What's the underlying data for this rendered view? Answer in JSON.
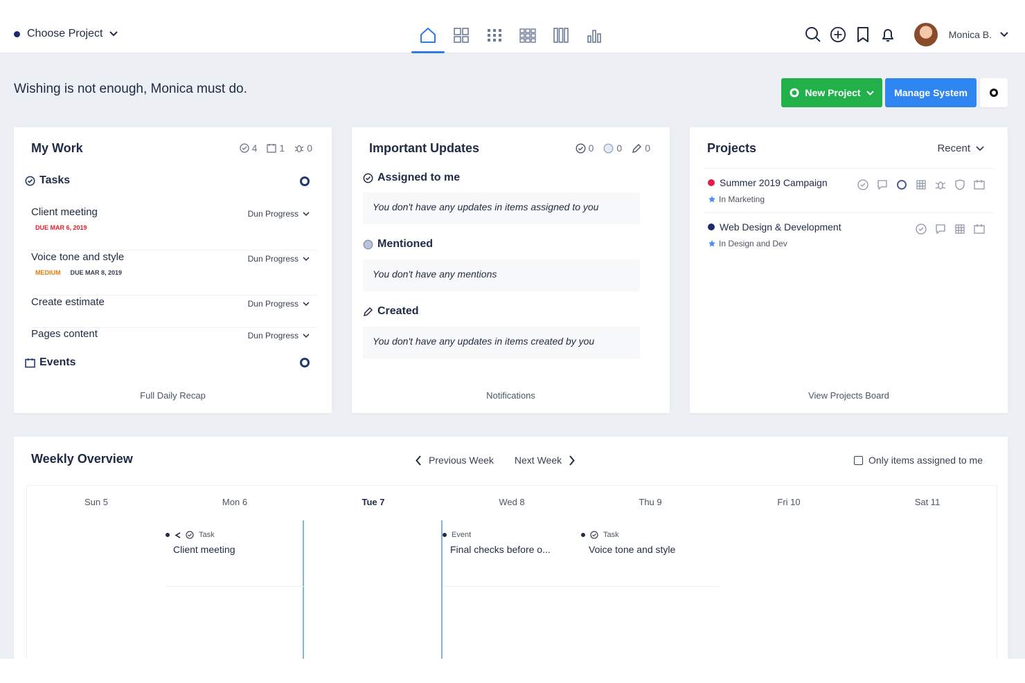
{
  "header": {
    "project_select": "Choose Project",
    "user_name": "Monica B.",
    "nav": [
      "home-icon",
      "grid-icon",
      "dots-grid-icon",
      "blocks-icon",
      "board-icon",
      "chart-icon"
    ]
  },
  "motto": "Wishing is not enough, Monica must do.",
  "actions": {
    "new_project": "New Project",
    "manage_system": "Manage System"
  },
  "my_work": {
    "title": "My Work",
    "counts": {
      "tasks": "4",
      "events": "1",
      "bugs": "0"
    },
    "tasks_label": "Tasks",
    "events_label": "Events",
    "status_label": "Dun Progress",
    "tasks": [
      {
        "name": "Client meeting",
        "due": "DUE MAR 6, 2019",
        "priority": ""
      },
      {
        "name": "Voice tone and style",
        "due": "DUE MAR 8, 2019",
        "priority": "MEDIUM"
      },
      {
        "name": "Create estimate",
        "due": "",
        "priority": ""
      },
      {
        "name": "Pages content",
        "due": "",
        "priority": ""
      }
    ],
    "footer": "Full Daily Recap"
  },
  "updates": {
    "title": "Important Updates",
    "counts": {
      "assigned": "0",
      "mentioned": "0",
      "created": "0"
    },
    "sections": [
      {
        "label": "Assigned to me",
        "text": "You don't have any updates in items assigned to you"
      },
      {
        "label": "Mentioned",
        "text": "You don't have any mentions"
      },
      {
        "label": "Created",
        "text": "You don't have any updates in items created by you"
      }
    ],
    "footer": "Notifications"
  },
  "projects": {
    "title": "Projects",
    "sort": "Recent",
    "items": [
      {
        "name": "Summer 2019 Campaign",
        "sub": "In Marketing",
        "color": "#e11d48"
      },
      {
        "name": "Web Design & Development",
        "sub": "In Design and Dev",
        "color": "#1f2a6b"
      }
    ],
    "footer": "View Projects Board"
  },
  "weekly": {
    "title": "Weekly Overview",
    "prev": "Previous Week",
    "next": "Next Week",
    "only_mine": "Only items assigned to me",
    "days": [
      "Sun 5",
      "Mon 6",
      "Tue 7",
      "Wed 8",
      "Thu 9",
      "Fri 10",
      "Sat 11"
    ],
    "events": [
      {
        "type": "Task",
        "title": "Client meeting"
      },
      {
        "type": "Event",
        "title": "Final checks before o..."
      },
      {
        "type": "Task",
        "title": "Voice tone and style"
      }
    ]
  },
  "colors": {
    "accent": "#2f7ae5",
    "green": "#22b04b",
    "blue": "#2f86f1",
    "due_red": "#e11d2e",
    "priority_orange": "#e07b0c"
  }
}
